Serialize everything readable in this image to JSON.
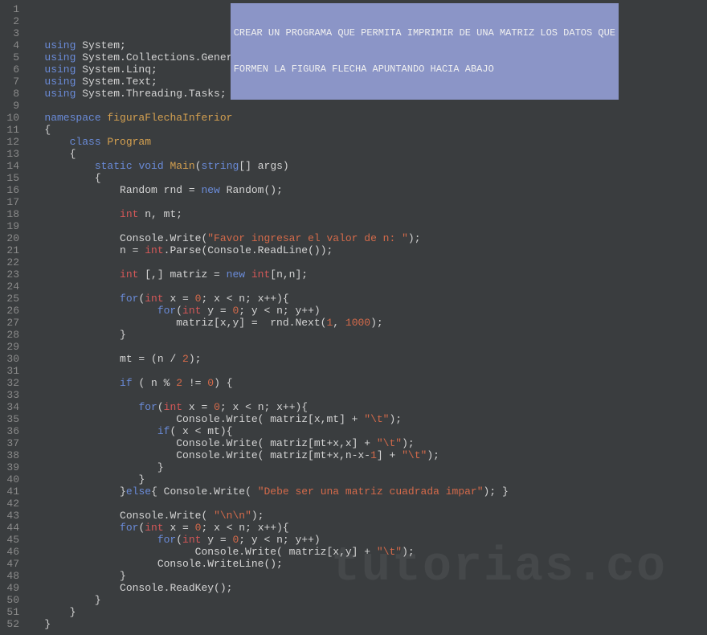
{
  "comment": {
    "line1": "CREAR UN PROGRAMA QUE PERMITA IMPRIMIR DE UNA MATRIZ LOS DATOS QUE",
    "line2": "FORMEN LA FIGURA FLECHA APUNTANDO HACIA ABAJO"
  },
  "watermark": "tutorias.co",
  "code": {
    "l4": {
      "kw": "using",
      "txt": " System;"
    },
    "l5": {
      "kw": "using",
      "txt": " System.Collections.Generic;"
    },
    "l6": {
      "kw": "using",
      "txt": " System.Linq;"
    },
    "l7": {
      "kw": "using",
      "txt": " System.Text;"
    },
    "l8": {
      "kw": "using",
      "txt": " System.Threading.Tasks;"
    },
    "l10": {
      "kw": "namespace",
      "cls": " figuraFlechaInferior"
    },
    "l11": "{",
    "l12": {
      "kw": "class",
      "cls": " Program"
    },
    "l13": "{",
    "l14": {
      "kw1": "static",
      "kw2": "void",
      "cls": "Main",
      "kw3": "string",
      "txt": "[] args)"
    },
    "l15": "{",
    "l16": {
      "txt1": "Random rnd = ",
      "kw": "new",
      "txt2": " Random();"
    },
    "l18": {
      "type": "int",
      "txt": " n, mt;"
    },
    "l20": {
      "txt1": "Console.Write(",
      "str": "\"Favor ingresar el valor de n: \"",
      "txt2": ");"
    },
    "l21": {
      "txt1": "n = ",
      "type": "int",
      "txt2": ".Parse(Console.ReadLine());"
    },
    "l23": {
      "type": "int",
      "txt1": " [,] matriz = ",
      "kw": "new",
      "type2": " int",
      "txt2": "[n,n];"
    },
    "l25": {
      "kw": "for",
      "txt1": "(",
      "type": "int",
      "txt2": " x = ",
      "num": "0",
      "txt3": "; x < n; x++){"
    },
    "l26": {
      "kw": "for",
      "txt1": "(",
      "type": "int",
      "txt2": " y = ",
      "num": "0",
      "txt3": "; y < n; y++)"
    },
    "l27": {
      "txt1": "matriz[x,y] =  rnd.Next(",
      "num1": "1",
      "txt2": ", ",
      "num2": "1000",
      "txt3": ");"
    },
    "l28": "}",
    "l30": {
      "txt1": "mt = (n / ",
      "num": "2",
      "txt2": ");"
    },
    "l32": {
      "kw": "if",
      "txt1": " ( n % ",
      "num1": "2",
      "txt2": " != ",
      "num2": "0",
      "txt3": ") {"
    },
    "l34": {
      "kw": "for",
      "txt1": "(",
      "type": "int",
      "txt2": " x = ",
      "num": "0",
      "txt3": "; x < n; x++){"
    },
    "l35": {
      "txt1": "Console.Write( matriz[x,mt] + ",
      "str": "\"\\t\"",
      "txt2": ");"
    },
    "l36": {
      "kw": "if",
      "txt": "( x < mt){"
    },
    "l37": {
      "txt1": "Console.Write( matriz[mt+x,x] + ",
      "str": "\"\\t\"",
      "txt2": ");"
    },
    "l38": {
      "txt1": "Console.Write( matriz[mt+x,n-x-",
      "num": "1",
      "txt2": "] + ",
      "str": "\"\\t\"",
      "txt3": ");"
    },
    "l39": "}",
    "l40": "}",
    "l41": {
      "txt1": "}",
      "kw": "else",
      "txt2": "{ Console.Write( ",
      "str": "\"Debe ser una matriz cuadrada impar\"",
      "txt3": "); }"
    },
    "l43": {
      "txt1": "Console.Write( ",
      "str": "\"\\n\\n\"",
      "txt2": ");"
    },
    "l44": {
      "kw": "for",
      "txt1": "(",
      "type": "int",
      "txt2": " x = ",
      "num": "0",
      "txt3": "; x < n; x++){"
    },
    "l45": {
      "kw": "for",
      "txt1": "(",
      "type": "int",
      "txt2": " y = ",
      "num": "0",
      "txt3": "; y < n; y++)"
    },
    "l46": {
      "txt1": "Console.Write( matriz[x,y] + ",
      "str": "\"\\t\"",
      "txt2": ");"
    },
    "l47": "Console.WriteLine();",
    "l48": "}",
    "l49": "Console.ReadKey();",
    "l50": "}",
    "l51": "}",
    "l52": "}"
  }
}
